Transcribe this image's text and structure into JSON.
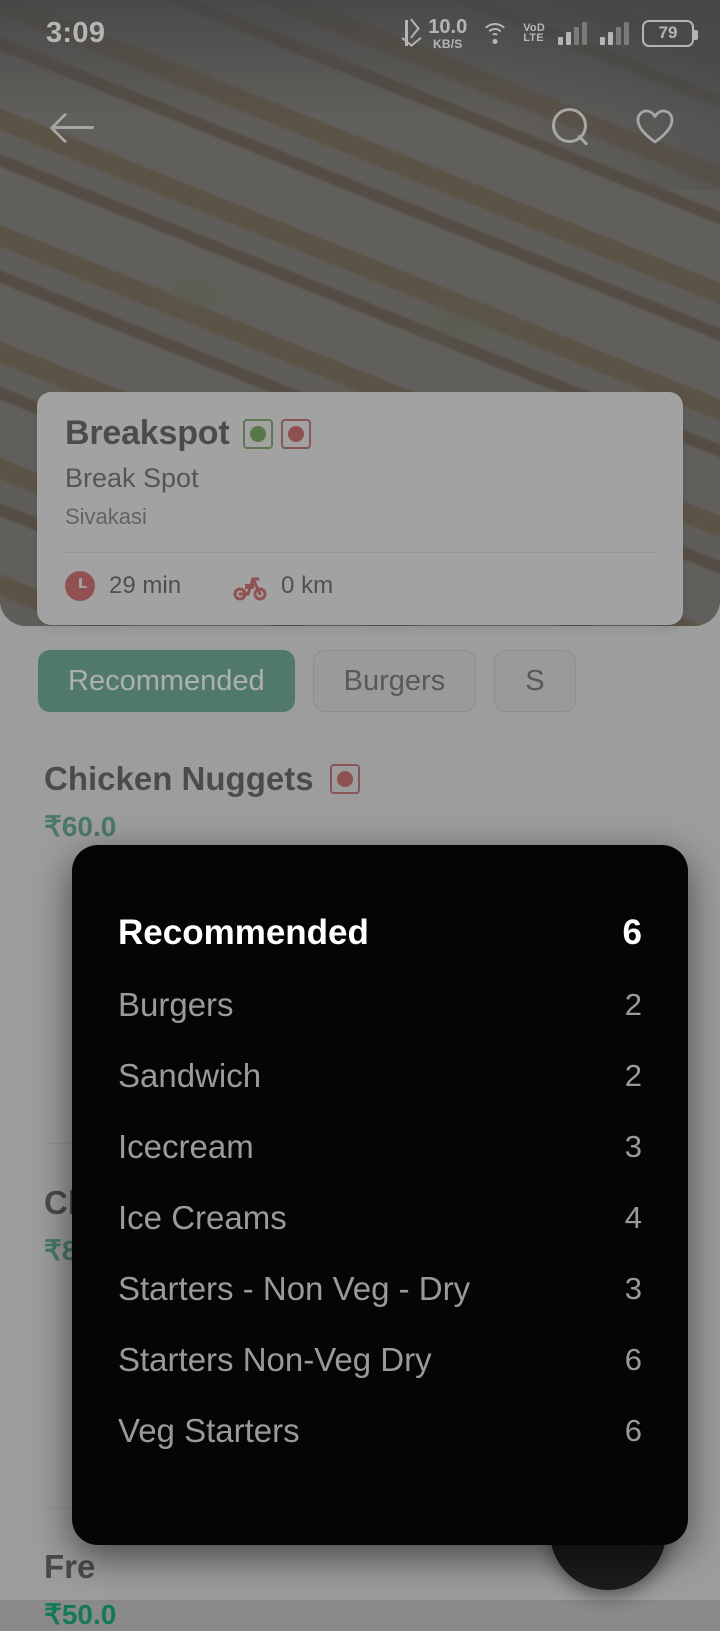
{
  "status_bar": {
    "time": "3:09",
    "bluetooth_icon": "bluetooth-icon",
    "network_speed_value": "10.0",
    "network_speed_unit": "KB/S",
    "wifi_icon": "wifi-icon",
    "volte_line1": "VoD",
    "volte_line2": "LTE",
    "signal_icon": "signal-bars-icon",
    "battery_level": "79"
  },
  "app_bar": {
    "back_icon": "back-arrow-icon",
    "search_icon": "search-icon",
    "favorite_icon": "heart-icon"
  },
  "restaurant": {
    "name": "Breakspot",
    "veg_marker": "veg-indicator",
    "nonveg_marker": "nonveg-indicator",
    "brand": "Break Spot",
    "location": "Sivakasi",
    "time_icon": "clock-icon",
    "time": "29 min",
    "distance_icon": "scooter-icon",
    "distance": "0 km"
  },
  "tabs": [
    {
      "label": "Recommended",
      "active": true
    },
    {
      "label": "Burgers",
      "active": false
    },
    {
      "label": "S",
      "active": false
    }
  ],
  "menu_items": [
    {
      "name": "Chicken Nuggets",
      "diet": "nonveg-indicator",
      "price": "₹60.0"
    },
    {
      "name": "Ch",
      "diet": "",
      "price": "₹8"
    },
    {
      "name": "Fre",
      "diet": "",
      "price": "₹50.0"
    }
  ],
  "category_sheet": {
    "rows": [
      {
        "label": "Recommended",
        "count": "6",
        "active": true
      },
      {
        "label": "Burgers",
        "count": "2",
        "active": false
      },
      {
        "label": "Sandwich",
        "count": "2",
        "active": false
      },
      {
        "label": "Icecream",
        "count": "3",
        "active": false
      },
      {
        "label": "Ice Creams",
        "count": "4",
        "active": false
      },
      {
        "label": "Starters - Non Veg - Dry",
        "count": "3",
        "active": false
      },
      {
        "label": "Starters Non-Veg Dry",
        "count": "6",
        "active": false
      },
      {
        "label": "Veg Starters",
        "count": "6",
        "active": false
      }
    ]
  },
  "colors": {
    "accent_green": "#1f7a5c",
    "price_green": "#13795b",
    "nonveg_red": "#a81f22",
    "veg_green": "#2f7a10",
    "sheet_bg": "#050505"
  }
}
